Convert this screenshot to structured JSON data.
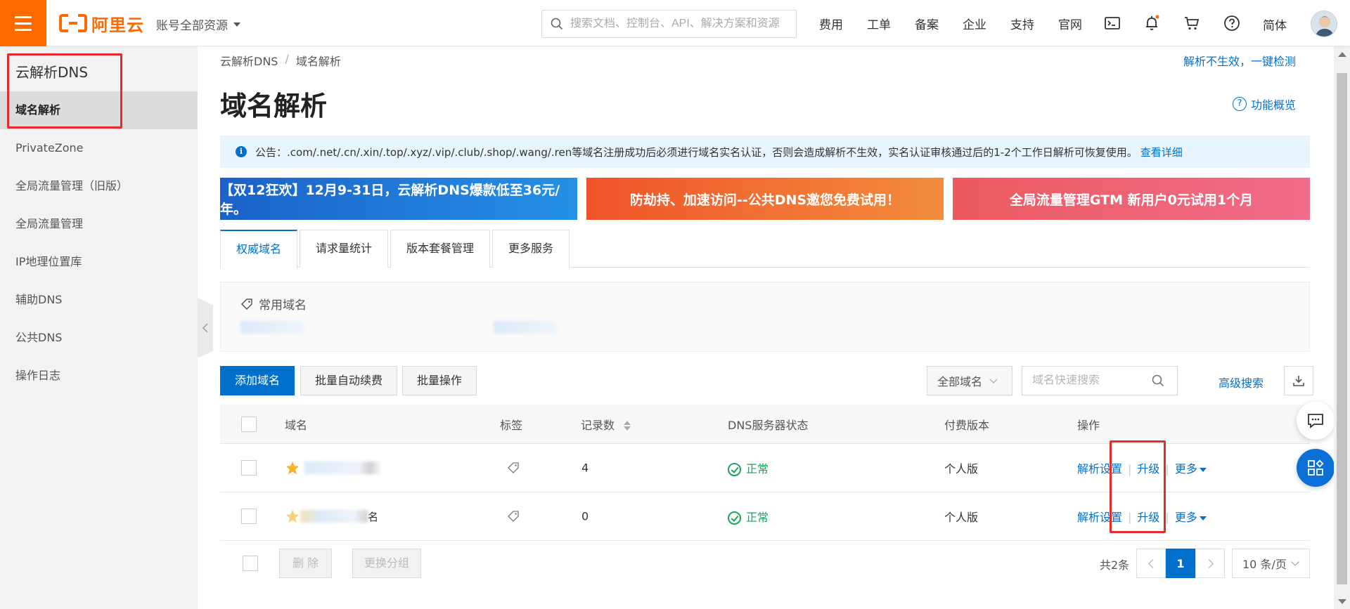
{
  "topbar": {
    "logo_text": "阿里云",
    "account_label": "账号全部资源",
    "search_placeholder": "搜索文档、控制台、API、解决方案和资源",
    "nav": [
      "费用",
      "工单",
      "备案",
      "企业",
      "支持",
      "官网"
    ],
    "lang": "简体",
    "brand_color": "#ff6a00"
  },
  "sidebar": {
    "title": "云解析DNS",
    "items": [
      {
        "label": "域名解析",
        "active": true
      },
      {
        "label": "PrivateZone"
      },
      {
        "label": "全局流量管理（旧版）"
      },
      {
        "label": "全局流量管理"
      },
      {
        "label": "IP地理位置库"
      },
      {
        "label": "辅助DNS"
      },
      {
        "label": "公共DNS"
      },
      {
        "label": "操作日志"
      }
    ]
  },
  "main": {
    "breadcrumb": [
      "云解析DNS",
      "域名解析"
    ],
    "top_right_link": "解析不生效，一键检测",
    "title": "域名解析",
    "feature_link": "功能概览",
    "notice": {
      "prefix": "公告：",
      "text": ".com/.net/.cn/.xin/.top/.xyz/.vip/.club/.shop/.wang/.ren等域名注册成功后必须进行域名实名认证，否则会造成解析不生效，实名认证审核通过后的1-2个工作日解析可恢复使用。",
      "link": "查看详细"
    },
    "banners": [
      "【双12狂欢】12月9-31日，云解析DNS爆款低至36元/年。",
      "防劫持、加速访问--公共DNS邀您免费试用！",
      "全局流量管理GTM 新用户0元试用1个月"
    ],
    "tabs": [
      "权威域名",
      "请求量统计",
      "版本套餐管理",
      "更多服务"
    ],
    "fav_title": "常用域名",
    "toolbar": {
      "add": "添加域名",
      "batch_renew": "批量自动续费",
      "batch_op": "批量操作",
      "filter_select": "全部域名",
      "quick_search_placeholder": "域名快速搜索",
      "advanced": "高级搜索"
    },
    "table": {
      "headers": [
        "域名",
        "标签",
        "记录数",
        "DNS服务器状态",
        "付费版本",
        "操作"
      ],
      "rows": [
        {
          "domain_suffix": "",
          "records": "4",
          "dns_status": "正常",
          "version": "个人版",
          "actions": [
            "解析设置",
            "升级",
            "更多"
          ]
        },
        {
          "domain_suffix": "名",
          "records": "0",
          "dns_status": "正常",
          "version": "个人版",
          "actions": [
            "解析设置",
            "升级",
            "更多"
          ]
        }
      ]
    },
    "footer": {
      "delete": "删 除",
      "change_group": "更换分组",
      "total": "共2条",
      "current_page": "1",
      "page_size": "10 条/页"
    }
  },
  "colors": {
    "accent": "#0070cc",
    "highlight_box": "#e52b2b",
    "status_ok": "#1aa55d"
  }
}
